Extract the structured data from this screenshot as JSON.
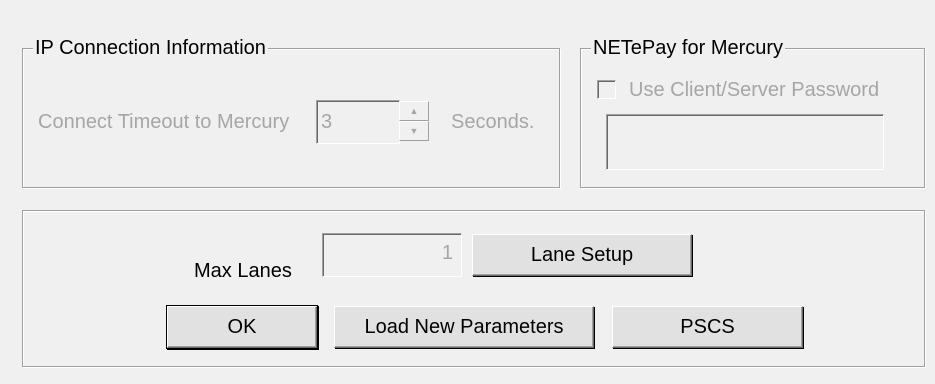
{
  "ip_group": {
    "title": "IP Connection  Information",
    "timeout_label": "Connect Timeout to Mercury",
    "timeout_value": "3",
    "seconds_label": "Seconds.",
    "spin_up_glyph": "▲",
    "spin_down_glyph": "▼"
  },
  "netepay_group": {
    "title": "NETePay for Mercury",
    "checkbox_label": "Use Client/Server Password",
    "checkbox_checked": false,
    "password_value": ""
  },
  "lanes": {
    "max_lanes_label": "Max Lanes",
    "max_lanes_value": "1",
    "lane_setup_button": "Lane Setup"
  },
  "buttons": {
    "ok": "OK",
    "load_params": "Load New Parameters",
    "pscs": "PSCS"
  }
}
